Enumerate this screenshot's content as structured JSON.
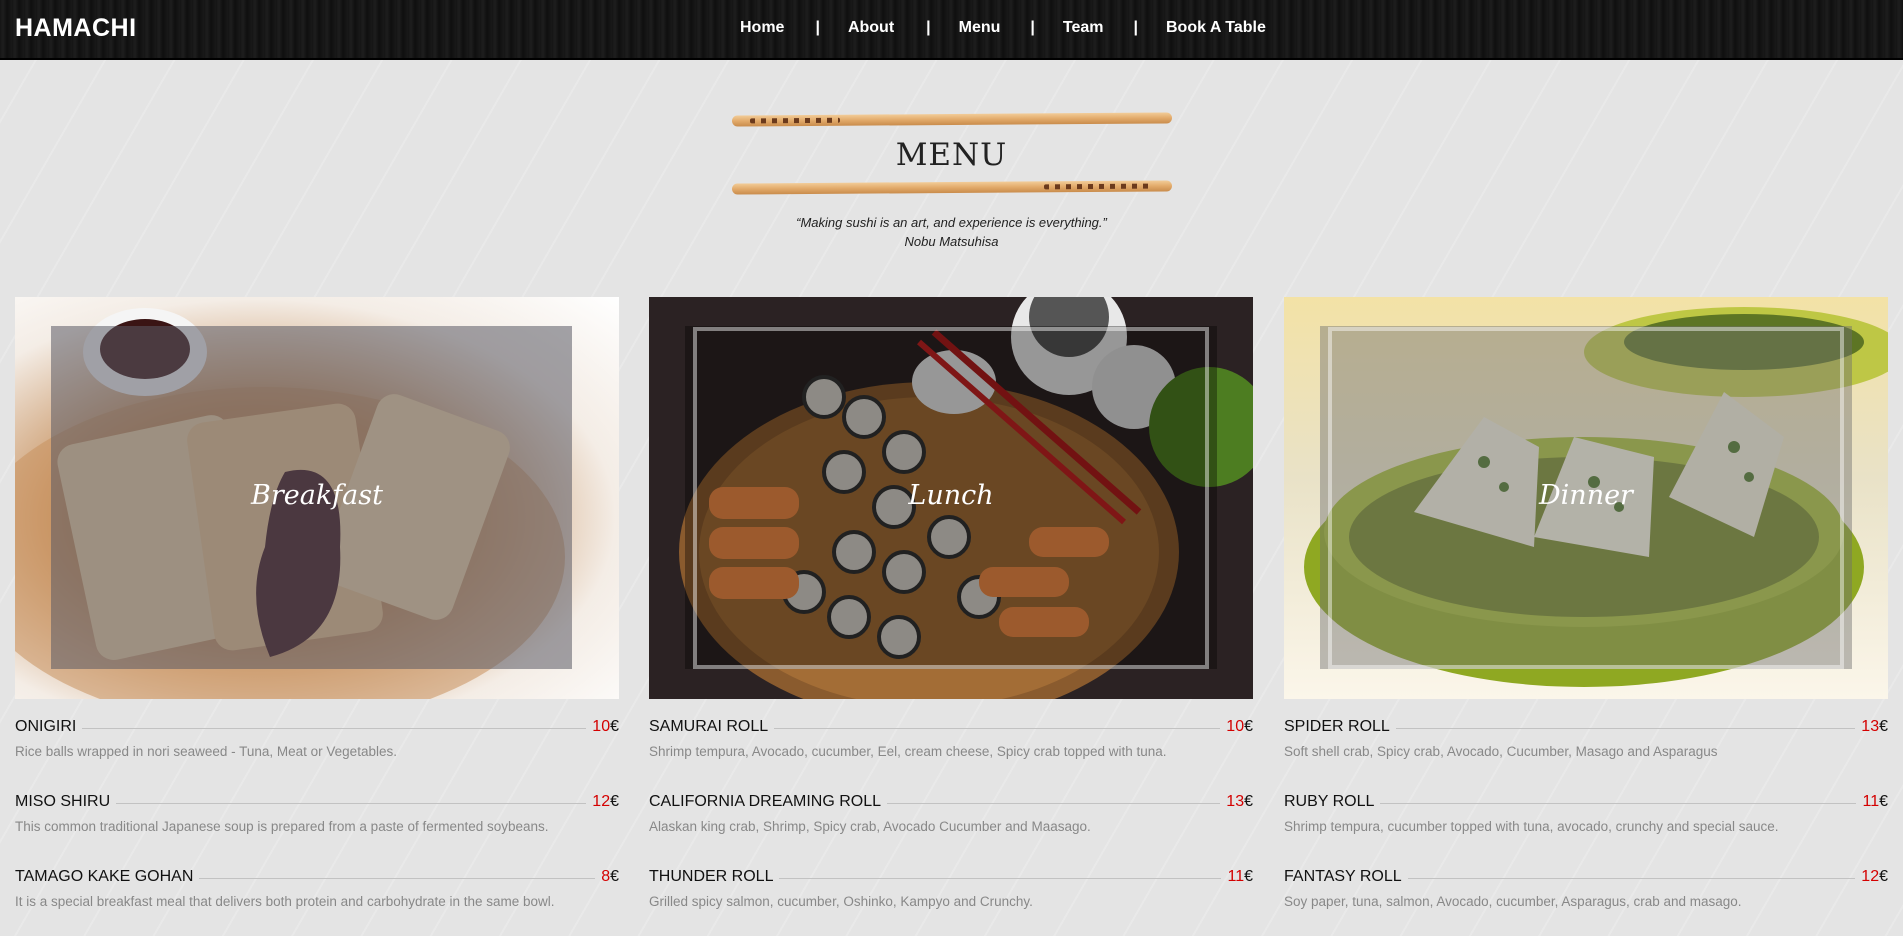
{
  "brand": "HAMACHI",
  "nav": {
    "items": [
      "Home",
      "About",
      "Menu",
      "Team",
      "Book A Table"
    ],
    "separator": "|"
  },
  "section": {
    "title": "MENU",
    "quote": "“Making sushi is an art, and experience is everything.”",
    "quote_author": "Nobu Matsuhisa"
  },
  "categories": [
    {
      "label": "Breakfast"
    },
    {
      "label": "Lunch"
    },
    {
      "label": "Dinner"
    }
  ],
  "currency": "€",
  "menu": {
    "breakfast": [
      {
        "name": "ONIGIRI",
        "price": "10",
        "desc": "Rice balls wrapped in nori seaweed - Tuna, Meat or Vegetables."
      },
      {
        "name": "MISO SHIRU",
        "price": "12",
        "desc": "This common traditional Japanese soup is prepared from a paste of fermented soybeans."
      },
      {
        "name": "TAMAGO KAKE GOHAN",
        "price": "8",
        "desc": "It is a special breakfast meal that delivers both protein and carbohydrate in the same bowl."
      }
    ],
    "lunch": [
      {
        "name": "SAMURAI ROLL",
        "price": "10",
        "desc": "Shrimp tempura, Avocado, cucumber, Eel, cream cheese, Spicy crab topped with tuna."
      },
      {
        "name": "CALIFORNIA DREAMING ROLL",
        "price": "13",
        "desc": "Alaskan king crab, Shrimp, Spicy crab, Avocado Cucumber and Maasago."
      },
      {
        "name": "THUNDER ROLL",
        "price": "11",
        "desc": "Grilled spicy salmon, cucumber, Oshinko, Kampyo and Crunchy."
      }
    ],
    "dinner": [
      {
        "name": "SPIDER ROLL",
        "price": "13",
        "desc": "Soft shell crab, Spicy crab, Avocado, Cucumber, Masago and Asparagus"
      },
      {
        "name": "RUBY ROLL",
        "price": "11",
        "desc": "Shrimp tempura, cucumber topped with tuna, avocado, crunchy and special sauce."
      },
      {
        "name": "FANTASY ROLL",
        "price": "12",
        "desc": "Soy paper, tuna, salmon, Avocado, cucumber, Asparagus, crab and masago."
      }
    ]
  }
}
